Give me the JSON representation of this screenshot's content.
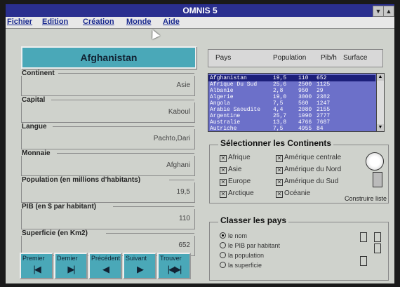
{
  "window": {
    "title": "OMNIS 5"
  },
  "menu": [
    "Fichier",
    "Edition",
    "Création",
    "Monde",
    "Aide"
  ],
  "country_title": "Afghanistan",
  "fields": [
    {
      "label": "Continent",
      "value": "Asie"
    },
    {
      "label": "Capital",
      "value": "Kaboul"
    },
    {
      "label": "Langue",
      "value": "Pachto,Dari"
    },
    {
      "label": "Monnaie",
      "value": "Afghani"
    },
    {
      "label": "Population (en millions d'habitants)",
      "value": "19,5"
    },
    {
      "label": "PIB (en $ par habitant)",
      "value": "110"
    },
    {
      "label": "Superficie (en Km2)",
      "value": "652"
    }
  ],
  "nav_buttons": [
    {
      "label": "Premier",
      "icon": "first-icon"
    },
    {
      "label": "Dernier",
      "icon": "last-icon"
    },
    {
      "label": "Précédent",
      "icon": "previous-icon"
    },
    {
      "label": "Suivant",
      "icon": "next-icon"
    },
    {
      "label": "Trouver",
      "icon": "find-icon"
    }
  ],
  "list_header": [
    "Pays",
    "Population",
    "Pib/h",
    "Surface"
  ],
  "list_rows": [
    [
      "Afghanistan",
      "19,5",
      "110",
      "652"
    ],
    [
      "Afrique Du Sud",
      "25,6",
      "2500",
      "1125"
    ],
    [
      "Albanie",
      "2,8",
      "950",
      "29"
    ],
    [
      "Algerie",
      "19,0",
      "3000",
      "2382"
    ],
    [
      "Angola",
      "7,5",
      "560",
      "1247"
    ],
    [
      "Arabie Saoudite",
      "4,4",
      "2080",
      "2155"
    ],
    [
      "Argentine",
      "25,7",
      "1990",
      "2777"
    ],
    [
      "Australie",
      "13,8",
      "4766",
      "7687"
    ],
    [
      "Autriche",
      "7,5",
      "4955",
      "84"
    ]
  ],
  "continents": {
    "title": "Sélectionner les Continents",
    "items": [
      "Afrique",
      "Asie",
      "Europe",
      "Arctique",
      "Amérique centrale",
      "Amérique du Nord",
      "Amérique du Sud",
      "Océanie"
    ],
    "build_label": "Construire liste"
  },
  "sort": {
    "title": "Classer les pays",
    "options": [
      "le nom",
      "le PIB par habitant",
      "la population",
      "la superficie"
    ],
    "selected": 0
  }
}
